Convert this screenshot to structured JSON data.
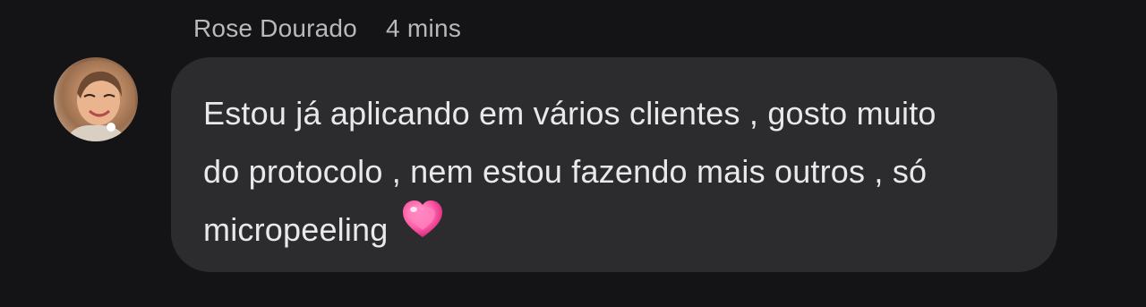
{
  "comment": {
    "author": "Rose Dourado",
    "timestamp": "4 mins",
    "message": "Estou já aplicando em vários clientes , gosto muito\ndo protocolo , nem estou fazendo mais outros , só\nmicropeeling",
    "emoji_icon": "sparkling-heart-icon"
  },
  "colors": {
    "background": "#141416",
    "bubble": "#2c2c2e",
    "meta_text": "#b9b9bd",
    "message_text": "#e9e9eb",
    "heart": "#ff5fa8"
  }
}
